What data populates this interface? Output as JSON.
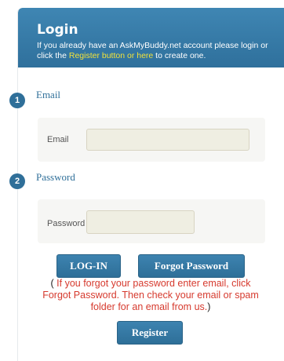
{
  "header": {
    "title": "Login",
    "desc_before": "If you already have an AskMyBuddy.net account please login or click the ",
    "desc_link": "Register button or here",
    "desc_after": " to create one."
  },
  "email_section": {
    "step_number": "1",
    "title": "Email",
    "field_label": "Email",
    "value": ""
  },
  "password_section": {
    "step_number": "2",
    "title": "Password",
    "field_label": "Password",
    "value": ""
  },
  "buttons": {
    "login": "LOG-IN",
    "forgot": "Forgot Password",
    "register": "Register"
  },
  "hint": {
    "open_paren": "( ",
    "text": "If you forgot your password enter email, click Forgot Password. Then check your email or spam folder for an email from us.",
    "close_paren": ")"
  },
  "colors": {
    "header_blue": "#3f86b3",
    "button_blue": "#2e6f98",
    "link_yellow": "#f2e23a",
    "hint_red": "#d63a2e"
  }
}
